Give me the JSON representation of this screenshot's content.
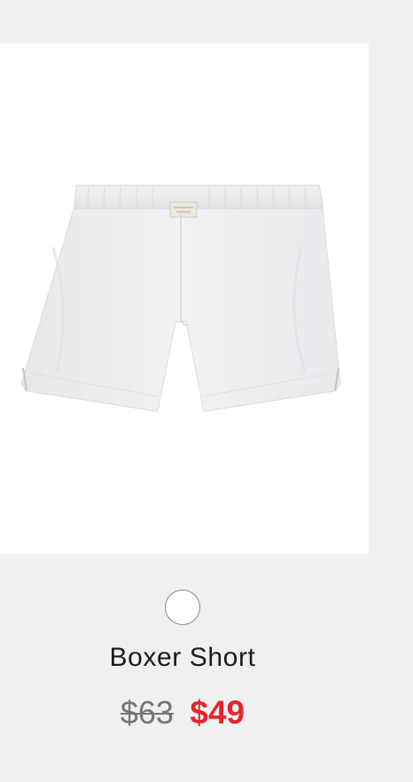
{
  "product": {
    "image_icon": "white-boxer-shorts-image",
    "swatches": [
      {
        "name": "white",
        "color": "#ffffff"
      }
    ],
    "name": "Boxer Short",
    "price_original": "$63",
    "price_sale": "$49"
  },
  "colors": {
    "background": "#eff0f2",
    "image_background": "#ffffff",
    "sale_price": "#e3262b",
    "original_price": "#757575",
    "text": "#1c1c1c"
  }
}
